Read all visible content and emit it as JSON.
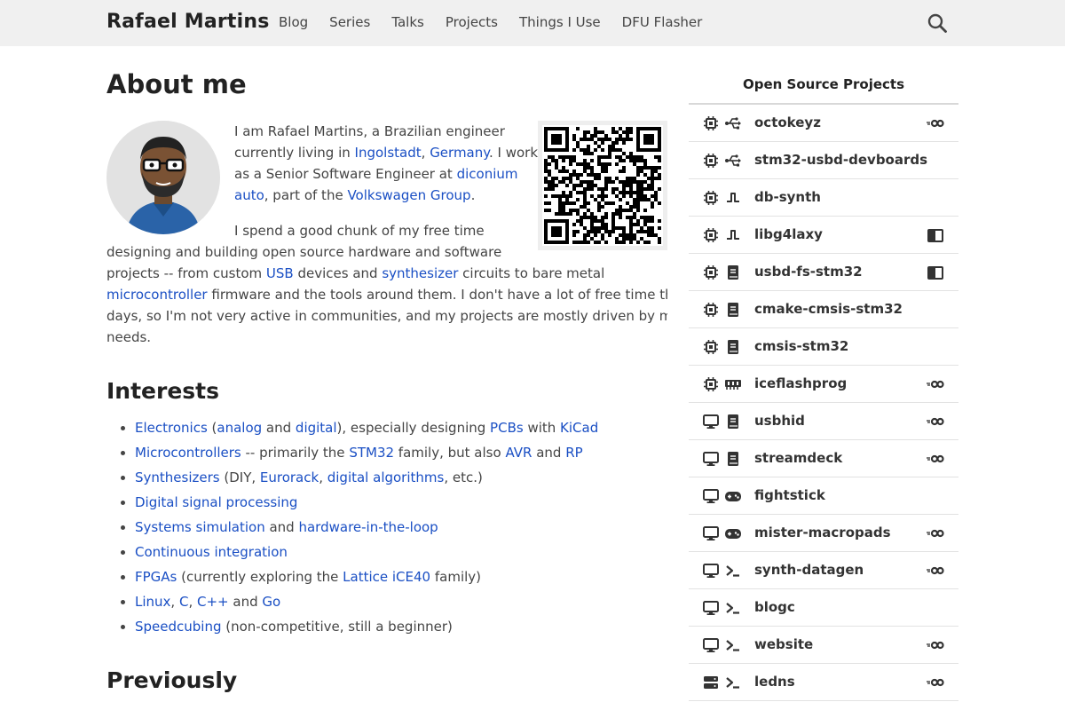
{
  "header": {
    "site_title": "Rafael Martins",
    "nav": [
      "Blog",
      "Series",
      "Talks",
      "Projects",
      "Things I Use",
      "DFU Flasher"
    ],
    "search_icon": "search-icon"
  },
  "about": {
    "title": "About me",
    "p1": [
      [
        {
          "t": "I am Rafael Martins, a Brazilian engineer"
        }
      ],
      [
        {
          "t": "currently living in "
        },
        {
          "t": "Ingolstadt",
          "l": 1
        },
        {
          "t": ", "
        },
        {
          "t": "Germany",
          "l": 1
        },
        {
          "t": ". I work"
        }
      ],
      [
        {
          "t": "as a Senior Software Engineer at "
        },
        {
          "t": "diconium",
          "l": 1
        }
      ],
      [
        {
          "t": "auto",
          "l": 1
        },
        {
          "t": ", part of the "
        },
        {
          "t": "Volkswagen Group",
          "l": 1
        },
        {
          "t": "."
        }
      ]
    ],
    "p2": [
      [
        {
          "t": "I spend a good chunk of my free time"
        }
      ],
      [
        {
          "t": "designing and building open source hardware and software"
        }
      ],
      [
        {
          "t": "projects -- from custom "
        },
        {
          "t": "USB",
          "l": 1
        },
        {
          "t": " devices and "
        },
        {
          "t": "synthesizer",
          "l": 1
        },
        {
          "t": " circuits to bare metal"
        }
      ],
      [
        {
          "t": "microcontroller",
          "l": 1
        },
        {
          "t": " firmware and the tools around them. I don't have a lot of free time these"
        }
      ],
      [
        {
          "t": "days, so I'm not very active in communities, and my projects are mostly driven by my own"
        }
      ],
      [
        {
          "t": "needs."
        }
      ]
    ]
  },
  "interests": {
    "title": "Interests",
    "items": [
      [
        {
          "t": "Electronics",
          "l": 1
        },
        {
          "t": " ("
        },
        {
          "t": "analog",
          "l": 1
        },
        {
          "t": " and "
        },
        {
          "t": "digital",
          "l": 1
        },
        {
          "t": "), especially designing "
        },
        {
          "t": "PCBs",
          "l": 1
        },
        {
          "t": " with "
        },
        {
          "t": "KiCad",
          "l": 1
        }
      ],
      [
        {
          "t": "Microcontrollers",
          "l": 1
        },
        {
          "t": " -- primarily the "
        },
        {
          "t": "STM32",
          "l": 1
        },
        {
          "t": " family, but also "
        },
        {
          "t": "AVR",
          "l": 1
        },
        {
          "t": " and "
        },
        {
          "t": "RP",
          "l": 1
        }
      ],
      [
        {
          "t": "Synthesizers",
          "l": 1
        },
        {
          "t": " (DIY, "
        },
        {
          "t": "Eurorack",
          "l": 1
        },
        {
          "t": ", "
        },
        {
          "t": "digital algorithms",
          "l": 1
        },
        {
          "t": ", etc.)"
        }
      ],
      [
        {
          "t": "Digital signal processing",
          "l": 1
        }
      ],
      [
        {
          "t": "Systems simulation",
          "l": 1
        },
        {
          "t": " and "
        },
        {
          "t": "hardware-in-the-loop",
          "l": 1
        }
      ],
      [
        {
          "t": "Continuous integration",
          "l": 1
        }
      ],
      [
        {
          "t": "FPGAs",
          "l": 1
        },
        {
          "t": " (currently exploring the "
        },
        {
          "t": "Lattice iCE40",
          "l": 1
        },
        {
          "t": " family)"
        }
      ],
      [
        {
          "t": "Linux",
          "l": 1
        },
        {
          "t": ", "
        },
        {
          "t": "C",
          "l": 1
        },
        {
          "t": ", "
        },
        {
          "t": "C++",
          "l": 1
        },
        {
          "t": " and "
        },
        {
          "t": "Go",
          "l": 1
        }
      ],
      [
        {
          "t": "Speedcubing",
          "l": 1
        },
        {
          "t": " (non-competitive, still a beginner)"
        }
      ]
    ]
  },
  "previously": {
    "title": "Previously"
  },
  "sidebar": {
    "title": "Open Source Projects",
    "projects": [
      {
        "name": "octokeyz",
        "platform": "chip-icon",
        "category": "usb-icon",
        "extra": "go-icon"
      },
      {
        "name": "stm32-usbd-devboards",
        "platform": "chip-icon",
        "category": "usb-icon",
        "extra": ""
      },
      {
        "name": "db-synth",
        "platform": "chip-icon",
        "category": "wave-icon",
        "extra": ""
      },
      {
        "name": "libg4laxy",
        "platform": "chip-icon",
        "category": "wave-icon",
        "extra": "book-icon"
      },
      {
        "name": "usbd-fs-stm32",
        "platform": "chip-icon",
        "category": "library-icon",
        "extra": "book-icon"
      },
      {
        "name": "cmake-cmsis-stm32",
        "platform": "chip-icon",
        "category": "library-icon",
        "extra": ""
      },
      {
        "name": "cmsis-stm32",
        "platform": "chip-icon",
        "category": "library-icon",
        "extra": ""
      },
      {
        "name": "iceflashprog",
        "platform": "chip-icon",
        "category": "memory-icon",
        "extra": "go-icon"
      },
      {
        "name": "usbhid",
        "platform": "monitor-icon",
        "category": "library-icon",
        "extra": "go-icon"
      },
      {
        "name": "streamdeck",
        "platform": "monitor-icon",
        "category": "library-icon",
        "extra": "go-icon"
      },
      {
        "name": "fightstick",
        "platform": "monitor-icon",
        "category": "gamepad-icon",
        "extra": ""
      },
      {
        "name": "mister-macropads",
        "platform": "monitor-icon",
        "category": "gamepad-icon",
        "extra": "go-icon"
      },
      {
        "name": "synth-datagen",
        "platform": "monitor-icon",
        "category": "terminal-icon",
        "extra": "go-icon"
      },
      {
        "name": "blogc",
        "platform": "monitor-icon",
        "category": "terminal-icon",
        "extra": ""
      },
      {
        "name": "website",
        "platform": "monitor-icon",
        "category": "terminal-icon",
        "extra": "go-icon"
      },
      {
        "name": "ledns",
        "platform": "server-icon",
        "category": "terminal-icon",
        "extra": "go-icon"
      }
    ]
  }
}
